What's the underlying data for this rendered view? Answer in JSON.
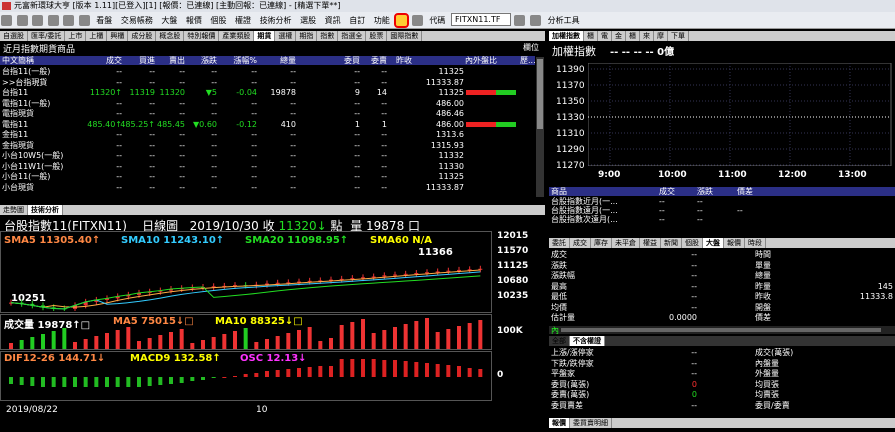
{
  "window": {
    "title": "元富新環球大亨 [版本 1.11][已登入][1] [報價：已連線] [主動回報：已連線] - [精選下單**]"
  },
  "toolbar": {
    "items": [
      "看盤",
      "交易帳務",
      "大盤",
      "報價",
      "個股",
      "權證",
      "技術分析",
      "選股",
      "資訊",
      "自訂",
      "功能",
      "代碼",
      "分析工具"
    ],
    "code_value": "FITXN11.TF"
  },
  "left_tabs": [
    "自選股",
    "匯率/委託",
    "上市",
    "上櫃",
    "興櫃",
    "成分股",
    "概念股",
    "特別報價",
    "產業類股",
    "期貨",
    "選權",
    "期指",
    "指數",
    "指選全",
    "股票",
    "國際指數"
  ],
  "left_tabs_active": 9,
  "quote_panel": {
    "title": "近月指數期貨商品",
    "corner": "欄位",
    "headers": [
      "中文簡稱",
      "成交",
      "買進",
      "賣出",
      "漲跌",
      "漲幅%",
      "總量",
      "委買",
      "委賣",
      "昨收",
      "內外盤比",
      "歷..."
    ],
    "rows": [
      {
        "name": "台指11(一般)",
        "c": [
          "--",
          "--",
          "--",
          "--",
          "--",
          "--",
          "--",
          "--",
          "11325"
        ],
        "color": "wht"
      },
      {
        "name": ">>台指現貨",
        "c": [
          "--",
          "--",
          "--",
          "--",
          "--",
          "--",
          "--",
          "--",
          "11333.87"
        ],
        "color": "wht"
      },
      {
        "name": "台指11",
        "c": [
          "11320↑",
          "11319",
          "11320",
          "▼5",
          "-0.04",
          "19878",
          "9",
          "14",
          "11325"
        ],
        "color": "grn",
        "bar": true
      },
      {
        "name": "電指11(一般)",
        "c": [
          "--",
          "--",
          "--",
          "--",
          "--",
          "--",
          "--",
          "--",
          "486.00"
        ],
        "color": "wht"
      },
      {
        "name": "電指現貨",
        "c": [
          "--",
          "--",
          "--",
          "--",
          "--",
          "--",
          "--",
          "--",
          "486.46"
        ],
        "color": "wht"
      },
      {
        "name": "電指11",
        "c": [
          "485.40↑",
          "485.25↑",
          "485.45",
          "▼0.60",
          "-0.12",
          "410",
          "1",
          "1",
          "486.00"
        ],
        "color": "grn",
        "bar": true
      },
      {
        "name": "金指11",
        "c": [
          "--",
          "--",
          "--",
          "--",
          "--",
          "--",
          "--",
          "--",
          "1313.6"
        ],
        "color": "wht"
      },
      {
        "name": "金指現貨",
        "c": [
          "--",
          "--",
          "--",
          "--",
          "--",
          "--",
          "--",
          "--",
          "1315.93"
        ],
        "color": "wht"
      },
      {
        "name": "小台10W5(一般)",
        "c": [
          "--",
          "--",
          "--",
          "--",
          "--",
          "--",
          "--",
          "--",
          "11332"
        ],
        "color": "wht"
      },
      {
        "name": "小台11W1(一般)",
        "c": [
          "--",
          "--",
          "--",
          "--",
          "--",
          "--",
          "--",
          "--",
          "11330"
        ],
        "color": "wht"
      },
      {
        "name": "小台11(一般)",
        "c": [
          "--",
          "--",
          "--",
          "--",
          "--",
          "--",
          "--",
          "--",
          "11325"
        ],
        "color": "wht"
      },
      {
        "name": "小台現貨",
        "c": [
          "--",
          "--",
          "--",
          "--",
          "--",
          "--",
          "--",
          "--",
          "11333.87"
        ],
        "color": "wht"
      }
    ]
  },
  "tech_tabs": [
    "走勢圖",
    "技術分析"
  ],
  "tech": {
    "title": "台股指數11(FITXN11)",
    "period": "日線圖",
    "date": "2019/10/30",
    "close_label": "收",
    "close": "11320",
    "unit": "點",
    "vol_label": "量",
    "vol": "19878",
    "vol_unit": "口",
    "sma5": "SMA5 11305.40↑",
    "sma10": "SMA10 11243.10↑",
    "sma20": "SMA20 11098.95↑",
    "sma60": "SMA60 N/A",
    "high_mark": "11366",
    "low_mark": "10251",
    "price_axis": [
      "12015",
      "11570",
      "11125",
      "10680",
      "10235"
    ],
    "vol_row": "成交量 19878↑□",
    "ma5": "MA5 75015↓□",
    "ma10": "MA10 88325↓□",
    "vol_axis": "100K",
    "dif": "DIF12-26 144.71↓",
    "macd": "MACD9 132.58↑",
    "osc": "OSC 12.13↓",
    "macd_axis": "0",
    "x_labels": [
      "2019/08/22",
      "10"
    ],
    "candles": [
      10450,
      10420,
      10380,
      10330,
      10300,
      10290,
      10380,
      10470,
      10520,
      10560,
      10610,
      10650,
      10700,
      10730,
      10760,
      10800,
      10820,
      10840,
      10850,
      10870,
      10880,
      10900,
      10890,
      10910,
      10940,
      10960,
      10970,
      10990,
      11010,
      11020,
      11040,
      11060,
      11080,
      11100,
      11120,
      11150,
      11170,
      11190,
      11210,
      11230,
      11250,
      11270,
      11290,
      11305,
      11320
    ]
  },
  "right_tabs": [
    "加權指數",
    "櫃",
    "電",
    "金",
    "櫃",
    "來",
    "摩",
    "下單"
  ],
  "intraday": {
    "title": "加權指數",
    "vals": "-- -- -- -- 0億",
    "y_axis": [
      "11390",
      "11370",
      "11350",
      "11330",
      "11310",
      "11290",
      "11270"
    ],
    "x_axis": [
      "9:00",
      "10:00",
      "11:00",
      "12:00",
      "13:00"
    ]
  },
  "spread": {
    "headers": [
      "商品",
      "成交",
      "漲跌",
      "價差"
    ],
    "rows": [
      [
        "台股指數近月(一...",
        "--",
        "--",
        ""
      ],
      [
        "台股指數遠月(一...",
        "--",
        "--",
        "--"
      ],
      [
        "台股指數次遠月(...",
        "--",
        "--",
        ""
      ]
    ]
  },
  "detail_tabs": [
    "委託",
    "成交",
    "庫存",
    "未平倉",
    "權益",
    "新聞",
    "個股",
    "大盤",
    "報價",
    "時段"
  ],
  "detail": {
    "left": [
      [
        "成交",
        "--"
      ],
      [
        "漲跌",
        "--"
      ],
      [
        "漲跌幅",
        "--"
      ],
      [
        "最高",
        "--"
      ],
      [
        "最低",
        "--"
      ],
      [
        "均價",
        "--"
      ],
      [
        "估計量",
        "0.0000"
      ]
    ],
    "right": [
      [
        "時間",
        ""
      ],
      [
        "單量",
        ""
      ],
      [
        "總量",
        ""
      ],
      [
        "昨量",
        "145"
      ],
      [
        "昨收",
        "11333.8"
      ],
      [
        "開盤",
        ""
      ],
      [
        "價差",
        ""
      ]
    ],
    "inner_label": "內",
    "sub_tabs": [
      "全部",
      "不含權證"
    ],
    "left2": [
      [
        "上漲/漲停家",
        "--"
      ],
      [
        "下跌/跌停家",
        "--"
      ],
      [
        "平盤家",
        "--"
      ],
      [
        "委買(萬張)",
        "0"
      ],
      [
        "委賣(萬張)",
        "0"
      ],
      [
        "委買賣差",
        "--"
      ]
    ],
    "right2": [
      [
        "成交(萬張)",
        ""
      ],
      [
        "內盤量",
        ""
      ],
      [
        "外盤量",
        ""
      ],
      [
        "均買張",
        ""
      ],
      [
        "均賣張",
        ""
      ],
      [
        "委買/委賣",
        ""
      ]
    ],
    "bottom_tabs": [
      "報價",
      "委買賣明細"
    ]
  }
}
